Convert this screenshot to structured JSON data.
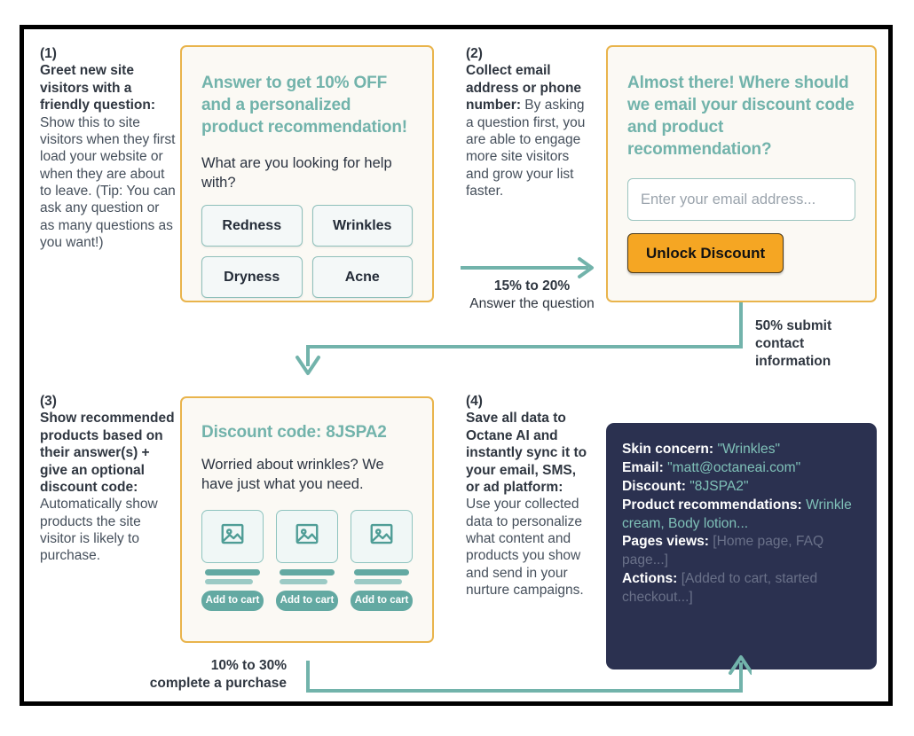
{
  "theme": {
    "frame_border": "#000000",
    "card_border": "#e9b44c",
    "card_bg": "#fbf9f4",
    "teal": "#72b3ab",
    "orange": "#f5a623",
    "panel_bg": "#2b3150",
    "connector": "#72b3ab"
  },
  "steps": {
    "one": {
      "number": "(1)",
      "title": "Greet new site visitors with a friendly question:",
      "body": " Show this to site visitors when they first load your website or when they are about to leave. (Tip: You can ask any question or as many questions as you want!)"
    },
    "two": {
      "number": "(2)",
      "title": "Collect email address or phone number:",
      "body": " By asking a question first, you are able to engage more site visitors and grow your list faster."
    },
    "three": {
      "number": "(3)",
      "title": "Show recommended products based on their answer(s) + give an optional discount code:",
      "body": " Automatically show products the site visitor is likely to purchase."
    },
    "four": {
      "number": "(4)",
      "title": "Save all data to Octane AI and instantly sync it to your email, SMS, or ad platform:",
      "body": " Use your collected data to personalize what content and products you show and send in your nurture campaigns."
    }
  },
  "card_quiz": {
    "heading": "Answer to get 10% OFF and a personalized product recommendation!",
    "question": "What are you looking for help with?",
    "options": [
      "Redness",
      "Wrinkles",
      "Dryness",
      "Acne"
    ]
  },
  "card_email": {
    "heading": "Almost there! Where should we email your discount code and product recommendation?",
    "input_placeholder": "Enter your email address...",
    "input_value": "",
    "button_label": "Unlock Discount"
  },
  "card_products": {
    "heading": "Discount code: 8JSPA2",
    "subtext": "Worried about wrinkles? We have just what you need.",
    "products": [
      {
        "cart_label": "Add to cart",
        "image_icon": "image-placeholder-icon"
      },
      {
        "cart_label": "Add to cart",
        "image_icon": "image-placeholder-icon"
      },
      {
        "cart_label": "Add to cart",
        "image_icon": "image-placeholder-icon"
      }
    ]
  },
  "data_panel": {
    "rows": [
      {
        "key": "Skin concern:",
        "value": " \"Wrinkles\"",
        "tone": "teal"
      },
      {
        "key": "Email:",
        "value": " \"matt@octaneai.com\"",
        "tone": "teal"
      },
      {
        "key": "Discount:",
        "value": " \"8JSPA2\"",
        "tone": "teal"
      },
      {
        "key": "Product recommendations:",
        "value": " Wrinkle cream, Body lotion...",
        "tone": "teal"
      },
      {
        "key": "Pages views:",
        "value": " [Home page, FAQ page...]",
        "tone": "grey"
      },
      {
        "key": "Actions:",
        "value": " [Added to cart, started checkout...]",
        "tone": "grey"
      }
    ]
  },
  "connectors": {
    "answer": {
      "stat": "15% to 20%",
      "text": "Answer the question"
    },
    "submit": {
      "stat": "50% submit",
      "text_line2": "contact",
      "text_line3": "information"
    },
    "purchase": {
      "stat": "10% to 30%",
      "text": "complete a purchase"
    }
  }
}
